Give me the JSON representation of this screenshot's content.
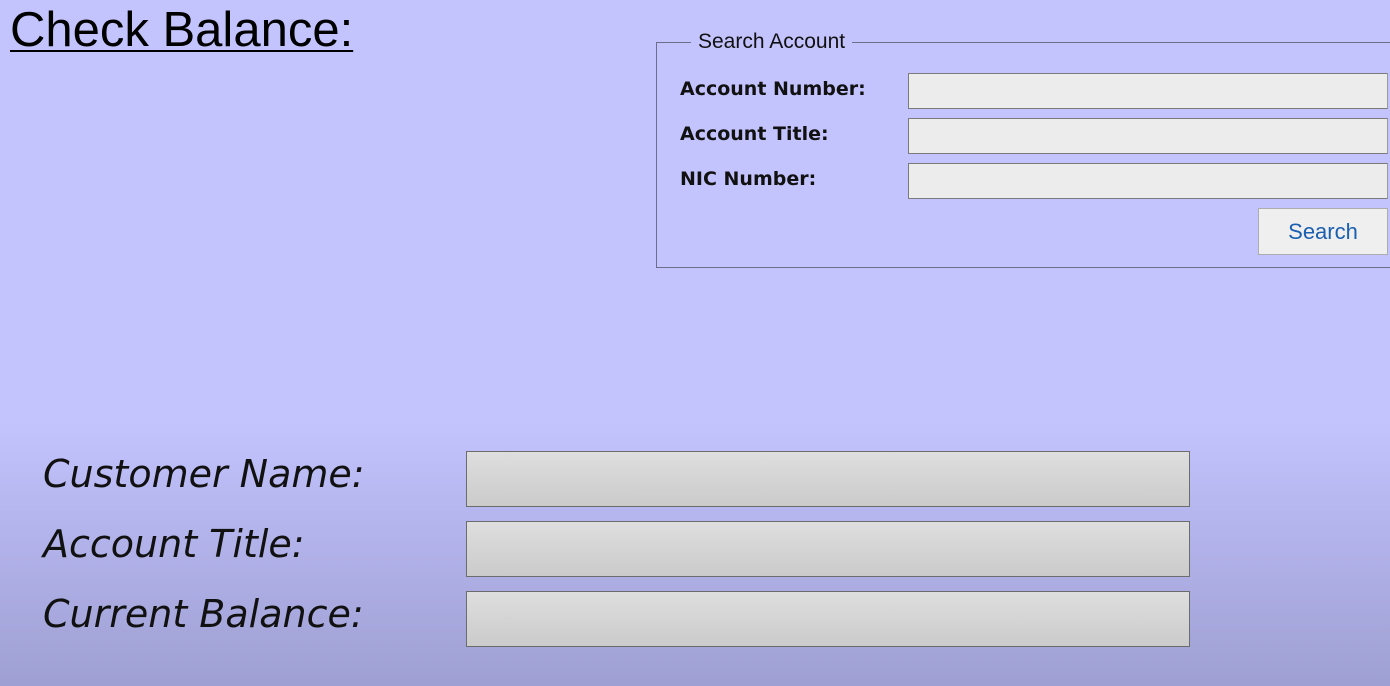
{
  "page": {
    "title": "Check Balance:"
  },
  "search_group": {
    "legend": "Search Account",
    "fields": [
      {
        "label": "Account Number:",
        "value": ""
      },
      {
        "label": "Account Title:",
        "value": ""
      },
      {
        "label": "NIC Number:",
        "value": ""
      }
    ],
    "button_label": "Search"
  },
  "results": [
    {
      "label": "Customer Name:",
      "value": ""
    },
    {
      "label": "Account Title:",
      "value": ""
    },
    {
      "label": "Current Balance:",
      "value": ""
    }
  ],
  "colors": {
    "background_top": "#c3c3fe",
    "background_bottom": "#9e9fd2",
    "button_text": "#1a5fb0"
  }
}
